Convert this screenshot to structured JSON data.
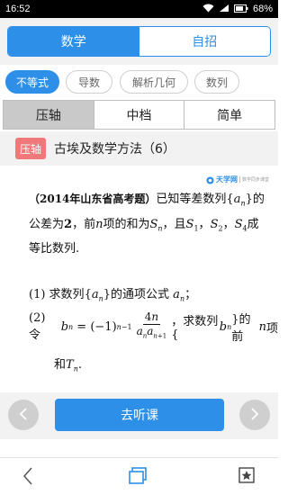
{
  "status_bar": {
    "time": "16:52",
    "battery": "68%"
  },
  "subject_tabs": [
    {
      "label": "数学",
      "active": true
    },
    {
      "label": "自招",
      "active": false
    }
  ],
  "topic_chips": [
    {
      "label": "不等式",
      "active": true
    },
    {
      "label": "导数",
      "active": false
    },
    {
      "label": "解析几何",
      "active": false
    },
    {
      "label": "数列",
      "active": false
    }
  ],
  "level_tabs": [
    {
      "label": "压轴",
      "active": true
    },
    {
      "label": "中档",
      "active": false
    },
    {
      "label": "简单",
      "active": false
    }
  ],
  "lesson": {
    "badge": "压轴",
    "title": "古埃及数学方法（6）"
  },
  "brand": {
    "name": "天学网",
    "tagline": "数学同步课堂"
  },
  "problem": {
    "source": "（2014年山东省高考题）",
    "q1_label": "(1) 求数列",
    "q2_label": "(2) 令"
  },
  "controls": {
    "listen_label": "去听课"
  },
  "colors": {
    "accent": "#2d8fe8",
    "badge": "#f07878",
    "level_active": "#c9c9c9"
  }
}
